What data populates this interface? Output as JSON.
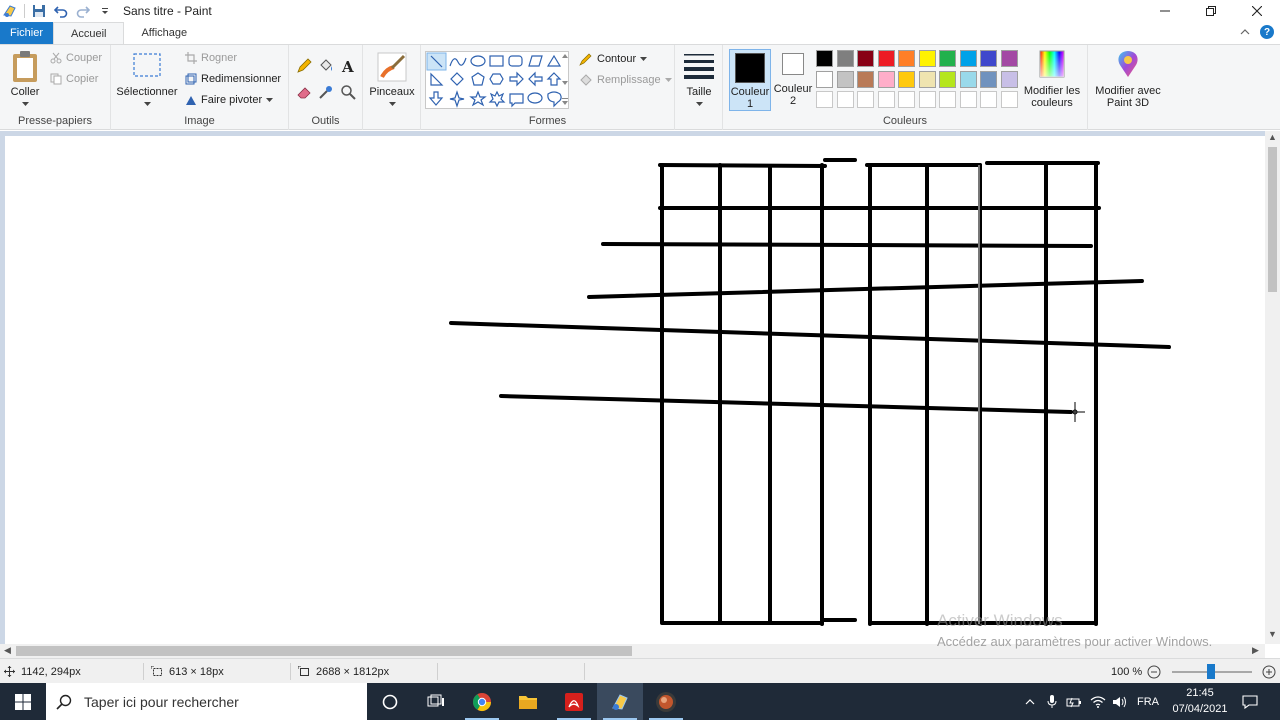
{
  "window": {
    "title": "Sans titre - Paint",
    "minimize_icon": "minimize-icon",
    "maximize_icon": "restore-icon",
    "close_icon": "close-icon"
  },
  "quick_access": {
    "items": [
      "paint-app-icon",
      "save-icon",
      "undo-icon",
      "redo-icon",
      "customize-dropdown-icon"
    ]
  },
  "tabs": {
    "file": "Fichier",
    "home": "Accueil",
    "view": "Affichage"
  },
  "ribbon": {
    "clipboard": {
      "label": "Presse-papiers",
      "paste": "Coller",
      "cut": "Couper",
      "copy": "Copier"
    },
    "image": {
      "label": "Image",
      "select": "Sélectionner",
      "crop": "Rogner",
      "resize": "Redimensionner",
      "rotate": "Faire pivoter"
    },
    "tools": {
      "label": "Outils"
    },
    "brushes": {
      "label": "Pinceaux"
    },
    "shapes": {
      "label": "Formes",
      "outline": "Contour",
      "fill": "Remplissage"
    },
    "size": {
      "label": "Taille"
    },
    "colors": {
      "label": "Couleurs",
      "color1_line1": "Couleur",
      "color1_line2": "1",
      "color2_line1": "Couleur",
      "color2_line2": "2",
      "edit_colors_line1": "Modifier les",
      "edit_colors_line2": "couleurs",
      "paint3d_line1": "Modifier avec",
      "paint3d_line2": "Paint 3D",
      "color1": "#000000",
      "color2": "#ffffff",
      "palette_row1": [
        "#000000",
        "#7f7f7f",
        "#880015",
        "#ed1c24",
        "#ff7f27",
        "#fff200",
        "#22b14c",
        "#00a2e8",
        "#3f48cc",
        "#a349a4"
      ],
      "palette_row2": [
        "#ffffff",
        "#c3c3c3",
        "#b97a57",
        "#ffaec9",
        "#ffc90e",
        "#efe4b0",
        "#b5e61d",
        "#99d9ea",
        "#7092be",
        "#c8bfe7"
      ]
    }
  },
  "canvas": {
    "background": "#ffffff"
  },
  "watermark": {
    "line1": "Activer Windows",
    "line2": "Accédez aux paramètres pour activer Windows."
  },
  "status": {
    "cursor_pos": "1142, 294px",
    "selection_size": "613 × 18px",
    "image_size": "2688 × 1812px",
    "zoom": "100 %"
  },
  "taskbar": {
    "search_placeholder": "Taper ici pour rechercher",
    "apps": [
      "cortana-icon",
      "task-view-icon",
      "chrome-icon",
      "file-explorer-icon",
      "acrobat-icon",
      "paint-icon",
      "media-app-icon"
    ],
    "language": "FRA",
    "time": "21:45",
    "date": "07/04/2021"
  }
}
